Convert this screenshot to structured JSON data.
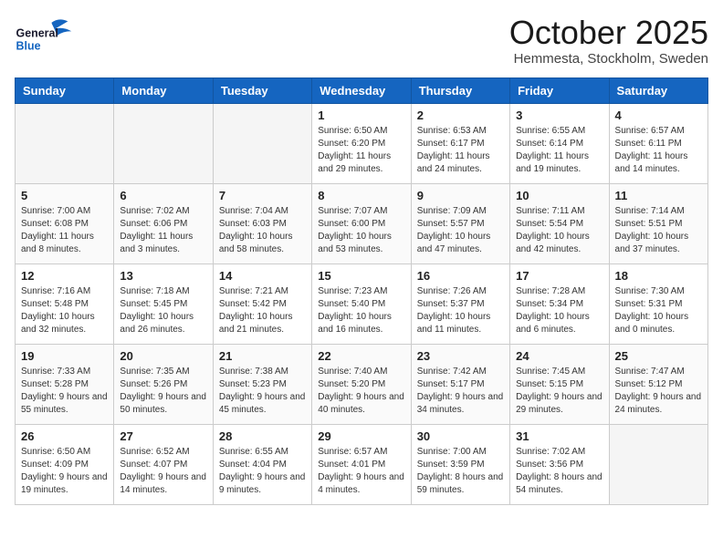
{
  "header": {
    "logo_line1": "General",
    "logo_line2": "Blue",
    "month": "October 2025",
    "location": "Hemmesta, Stockholm, Sweden"
  },
  "weekdays": [
    "Sunday",
    "Monday",
    "Tuesday",
    "Wednesday",
    "Thursday",
    "Friday",
    "Saturday"
  ],
  "weeks": [
    [
      {
        "day": null
      },
      {
        "day": null
      },
      {
        "day": null
      },
      {
        "day": "1",
        "sunrise": "6:50 AM",
        "sunset": "6:20 PM",
        "daylight": "11 hours and 29 minutes."
      },
      {
        "day": "2",
        "sunrise": "6:53 AM",
        "sunset": "6:17 PM",
        "daylight": "11 hours and 24 minutes."
      },
      {
        "day": "3",
        "sunrise": "6:55 AM",
        "sunset": "6:14 PM",
        "daylight": "11 hours and 19 minutes."
      },
      {
        "day": "4",
        "sunrise": "6:57 AM",
        "sunset": "6:11 PM",
        "daylight": "11 hours and 14 minutes."
      }
    ],
    [
      {
        "day": "5",
        "sunrise": "7:00 AM",
        "sunset": "6:08 PM",
        "daylight": "11 hours and 8 minutes."
      },
      {
        "day": "6",
        "sunrise": "7:02 AM",
        "sunset": "6:06 PM",
        "daylight": "11 hours and 3 minutes."
      },
      {
        "day": "7",
        "sunrise": "7:04 AM",
        "sunset": "6:03 PM",
        "daylight": "10 hours and 58 minutes."
      },
      {
        "day": "8",
        "sunrise": "7:07 AM",
        "sunset": "6:00 PM",
        "daylight": "10 hours and 53 minutes."
      },
      {
        "day": "9",
        "sunrise": "7:09 AM",
        "sunset": "5:57 PM",
        "daylight": "10 hours and 47 minutes."
      },
      {
        "day": "10",
        "sunrise": "7:11 AM",
        "sunset": "5:54 PM",
        "daylight": "10 hours and 42 minutes."
      },
      {
        "day": "11",
        "sunrise": "7:14 AM",
        "sunset": "5:51 PM",
        "daylight": "10 hours and 37 minutes."
      }
    ],
    [
      {
        "day": "12",
        "sunrise": "7:16 AM",
        "sunset": "5:48 PM",
        "daylight": "10 hours and 32 minutes."
      },
      {
        "day": "13",
        "sunrise": "7:18 AM",
        "sunset": "5:45 PM",
        "daylight": "10 hours and 26 minutes."
      },
      {
        "day": "14",
        "sunrise": "7:21 AM",
        "sunset": "5:42 PM",
        "daylight": "10 hours and 21 minutes."
      },
      {
        "day": "15",
        "sunrise": "7:23 AM",
        "sunset": "5:40 PM",
        "daylight": "10 hours and 16 minutes."
      },
      {
        "day": "16",
        "sunrise": "7:26 AM",
        "sunset": "5:37 PM",
        "daylight": "10 hours and 11 minutes."
      },
      {
        "day": "17",
        "sunrise": "7:28 AM",
        "sunset": "5:34 PM",
        "daylight": "10 hours and 6 minutes."
      },
      {
        "day": "18",
        "sunrise": "7:30 AM",
        "sunset": "5:31 PM",
        "daylight": "10 hours and 0 minutes."
      }
    ],
    [
      {
        "day": "19",
        "sunrise": "7:33 AM",
        "sunset": "5:28 PM",
        "daylight": "9 hours and 55 minutes."
      },
      {
        "day": "20",
        "sunrise": "7:35 AM",
        "sunset": "5:26 PM",
        "daylight": "9 hours and 50 minutes."
      },
      {
        "day": "21",
        "sunrise": "7:38 AM",
        "sunset": "5:23 PM",
        "daylight": "9 hours and 45 minutes."
      },
      {
        "day": "22",
        "sunrise": "7:40 AM",
        "sunset": "5:20 PM",
        "daylight": "9 hours and 40 minutes."
      },
      {
        "day": "23",
        "sunrise": "7:42 AM",
        "sunset": "5:17 PM",
        "daylight": "9 hours and 34 minutes."
      },
      {
        "day": "24",
        "sunrise": "7:45 AM",
        "sunset": "5:15 PM",
        "daylight": "9 hours and 29 minutes."
      },
      {
        "day": "25",
        "sunrise": "7:47 AM",
        "sunset": "5:12 PM",
        "daylight": "9 hours and 24 minutes."
      }
    ],
    [
      {
        "day": "26",
        "sunrise": "6:50 AM",
        "sunset": "4:09 PM",
        "daylight": "9 hours and 19 minutes."
      },
      {
        "day": "27",
        "sunrise": "6:52 AM",
        "sunset": "4:07 PM",
        "daylight": "9 hours and 14 minutes."
      },
      {
        "day": "28",
        "sunrise": "6:55 AM",
        "sunset": "4:04 PM",
        "daylight": "9 hours and 9 minutes."
      },
      {
        "day": "29",
        "sunrise": "6:57 AM",
        "sunset": "4:01 PM",
        "daylight": "9 hours and 4 minutes."
      },
      {
        "day": "30",
        "sunrise": "7:00 AM",
        "sunset": "3:59 PM",
        "daylight": "8 hours and 59 minutes."
      },
      {
        "day": "31",
        "sunrise": "7:02 AM",
        "sunset": "3:56 PM",
        "daylight": "8 hours and 54 minutes."
      },
      {
        "day": null
      }
    ]
  ],
  "labels": {
    "sunrise_prefix": "Sunrise: ",
    "sunset_prefix": "Sunset: ",
    "daylight_prefix": "Daylight: "
  }
}
